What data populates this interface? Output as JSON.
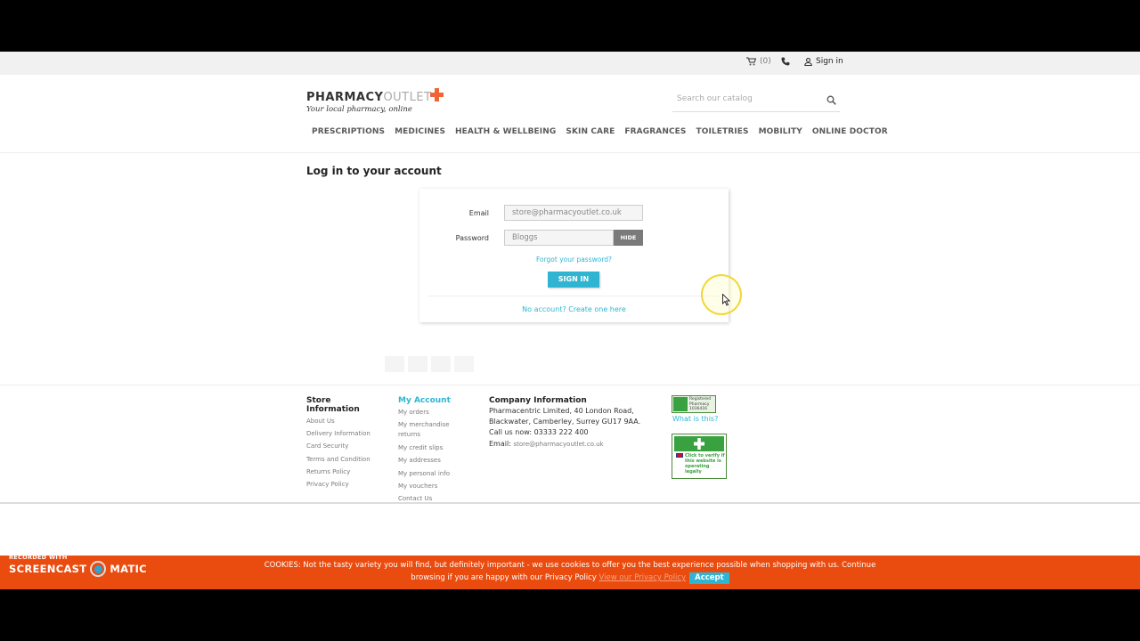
{
  "topbar": {
    "cart_label": "(0)",
    "signin_label": "Sign in"
  },
  "logo": {
    "brand_main": "PHARMACY",
    "brand_thin": "OUTLET",
    "tagline": "Your local pharmacy, online"
  },
  "search": {
    "placeholder": "Search our catalog"
  },
  "nav": {
    "items": [
      "PRESCRIPTIONS",
      "MEDICINES",
      "HEALTH & WELLBEING",
      "SKIN CARE",
      "FRAGRANCES",
      "TOILETRIES",
      "MOBILITY",
      "ONLINE DOCTOR"
    ]
  },
  "page_title": "Log in to your account",
  "login": {
    "email_label": "Email",
    "email_value": "store@pharmacyoutlet.co.uk",
    "password_label": "Password",
    "password_value": "Bloggs",
    "hide_label": "HIDE",
    "forgot_label": "Forgot your password?",
    "signin_label": "SIGN IN",
    "no_account_label": "No account? Create one here"
  },
  "footer": {
    "store_title": "Store Information",
    "store_links": [
      "About Us",
      "Delivery Information",
      "Card Security",
      "Terms and Condition",
      "Returns Policy",
      "Privacy Policy"
    ],
    "account_title": "My Account",
    "account_links": [
      "My orders",
      "My merchandise returns",
      "My credit slips",
      "My addresses",
      "My personal info",
      "My vouchers",
      "Contact Us"
    ],
    "company_title": "Company Information",
    "company_address_1": "Pharmacentric Limited, 40 London Road,",
    "company_address_2": "Blackwater, Camberley, Surrey GU17 9AA.",
    "company_phone": "Call us now: 03333 222 400",
    "company_email_label": "Email:",
    "company_email": "store@pharmacyoutlet.co.uk",
    "badge1_text_1": "Registered",
    "badge1_text_2": "Pharmacy",
    "badge1_text_3": "1036416",
    "what_is_this": "What is this?",
    "badge2_text": "Click to verify if this website is operating legally"
  },
  "cookie": {
    "text_1": "COOKIES: Not the tasty variety you will find, but definitely important - we use cookies to offer you the best experience possible when shopping with us. Continue",
    "text_2": "browsing if you are happy with our Privacy Policy",
    "link": "View our Privacy Policy",
    "accept": "Accept"
  },
  "recorder": {
    "small": "RECORDED WITH",
    "left": "SCREENCAST",
    "right": "MATIC"
  },
  "colors": {
    "accent": "#2fb5d2",
    "cookie_bg": "#ea4b0f",
    "logo_cross": "#f16334"
  }
}
